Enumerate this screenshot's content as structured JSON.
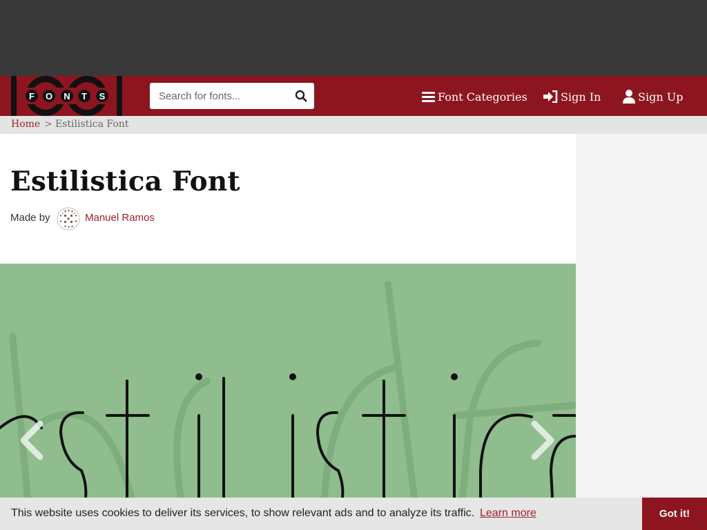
{
  "site": {
    "logo_text_top": "1001",
    "logo_text_bottom": "FONTS"
  },
  "header": {
    "search_placeholder": "Search for fonts...",
    "nav": {
      "font_categories": "Font Categories",
      "sign_in": "Sign In",
      "sign_up": "Sign Up"
    }
  },
  "breadcrumb": {
    "home": "Home",
    "separator": ">",
    "current": "Estilistica Font"
  },
  "page": {
    "title": "Estilistica Font",
    "made_by_label": "Made by",
    "author": "Manuel Ramos"
  },
  "preview": {
    "sample_text": "estilistica",
    "background_color": "#8fbd8e",
    "prev_icon": "chevron-left-icon",
    "next_icon": "chevron-right-icon"
  },
  "cookie_banner": {
    "message": "This website uses cookies to deliver its services, to show relevant ads and to analyze its traffic.",
    "learn_more": "Learn more",
    "accept": "Got it!"
  },
  "colors": {
    "brand_red": "#8d1520",
    "link_red": "#a0202a",
    "ad_gray": "#393939"
  }
}
